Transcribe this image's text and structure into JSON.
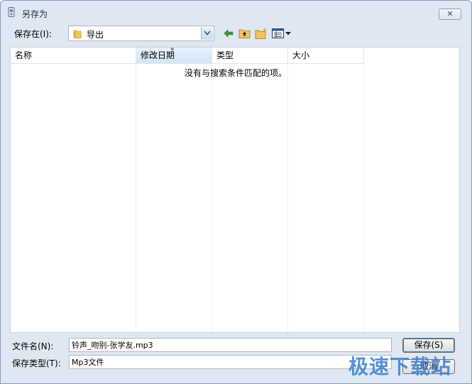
{
  "window": {
    "title": "另存为",
    "close_label": "✕"
  },
  "toolbar": {
    "save_in_label": "保存在(I):",
    "location": "导出",
    "buttons": [
      "back-icon",
      "up-folder-icon",
      "new-folder-icon",
      "view-menu-icon"
    ]
  },
  "file_list": {
    "columns": [
      "名称",
      "修改日期",
      "类型",
      "大小"
    ],
    "sorted_column": "修改日期",
    "empty_message": "没有与搜索条件匹配的项。"
  },
  "form": {
    "filename_label": "文件名(N):",
    "filename_value": "铃声_吻别-张学友.mp3",
    "filetype_label": "保存类型(T):",
    "filetype_value": "Mp3文件"
  },
  "buttons": {
    "save": "保存(S)",
    "cancel": "取消"
  },
  "watermark": "极速下载站"
}
